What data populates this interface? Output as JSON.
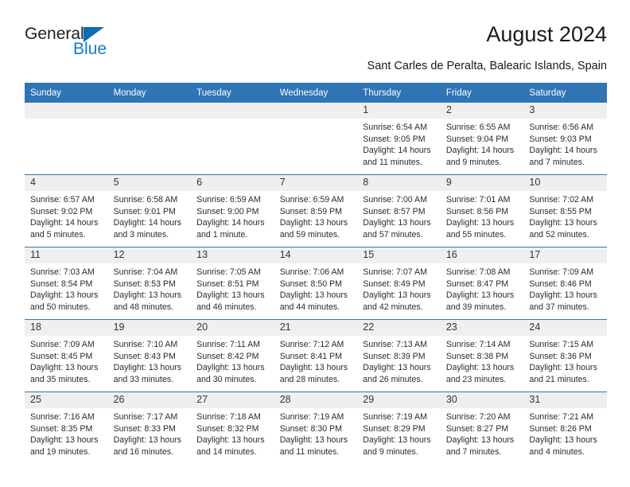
{
  "brand": {
    "name_top": "General",
    "name_bottom": "Blue",
    "triangle_color": "#0b6cb7",
    "text_color": "#231f20",
    "blue_color": "#0f7dc8"
  },
  "header": {
    "title": "August 2024",
    "subtitle": "Sant Carles de Peralta, Balearic Islands, Spain"
  },
  "theme": {
    "header_bg": "#2f74b5",
    "header_text": "#ffffff",
    "daynum_bg": "#efefef",
    "row_divider": "#2f74b5",
    "body_text": "#2b2b2b"
  },
  "calendar": {
    "weekday_headers": [
      "Sunday",
      "Monday",
      "Tuesday",
      "Wednesday",
      "Thursday",
      "Friday",
      "Saturday"
    ],
    "weeks": [
      [
        {
          "day": "",
          "lines": []
        },
        {
          "day": "",
          "lines": []
        },
        {
          "day": "",
          "lines": []
        },
        {
          "day": "",
          "lines": []
        },
        {
          "day": "1",
          "lines": [
            "Sunrise: 6:54 AM",
            "Sunset: 9:05 PM",
            "Daylight: 14 hours",
            "and 11 minutes."
          ]
        },
        {
          "day": "2",
          "lines": [
            "Sunrise: 6:55 AM",
            "Sunset: 9:04 PM",
            "Daylight: 14 hours",
            "and 9 minutes."
          ]
        },
        {
          "day": "3",
          "lines": [
            "Sunrise: 6:56 AM",
            "Sunset: 9:03 PM",
            "Daylight: 14 hours",
            "and 7 minutes."
          ]
        }
      ],
      [
        {
          "day": "4",
          "lines": [
            "Sunrise: 6:57 AM",
            "Sunset: 9:02 PM",
            "Daylight: 14 hours",
            "and 5 minutes."
          ]
        },
        {
          "day": "5",
          "lines": [
            "Sunrise: 6:58 AM",
            "Sunset: 9:01 PM",
            "Daylight: 14 hours",
            "and 3 minutes."
          ]
        },
        {
          "day": "6",
          "lines": [
            "Sunrise: 6:59 AM",
            "Sunset: 9:00 PM",
            "Daylight: 14 hours",
            "and 1 minute."
          ]
        },
        {
          "day": "7",
          "lines": [
            "Sunrise: 6:59 AM",
            "Sunset: 8:59 PM",
            "Daylight: 13 hours",
            "and 59 minutes."
          ]
        },
        {
          "day": "8",
          "lines": [
            "Sunrise: 7:00 AM",
            "Sunset: 8:57 PM",
            "Daylight: 13 hours",
            "and 57 minutes."
          ]
        },
        {
          "day": "9",
          "lines": [
            "Sunrise: 7:01 AM",
            "Sunset: 8:56 PM",
            "Daylight: 13 hours",
            "and 55 minutes."
          ]
        },
        {
          "day": "10",
          "lines": [
            "Sunrise: 7:02 AM",
            "Sunset: 8:55 PM",
            "Daylight: 13 hours",
            "and 52 minutes."
          ]
        }
      ],
      [
        {
          "day": "11",
          "lines": [
            "Sunrise: 7:03 AM",
            "Sunset: 8:54 PM",
            "Daylight: 13 hours",
            "and 50 minutes."
          ]
        },
        {
          "day": "12",
          "lines": [
            "Sunrise: 7:04 AM",
            "Sunset: 8:53 PM",
            "Daylight: 13 hours",
            "and 48 minutes."
          ]
        },
        {
          "day": "13",
          "lines": [
            "Sunrise: 7:05 AM",
            "Sunset: 8:51 PM",
            "Daylight: 13 hours",
            "and 46 minutes."
          ]
        },
        {
          "day": "14",
          "lines": [
            "Sunrise: 7:06 AM",
            "Sunset: 8:50 PM",
            "Daylight: 13 hours",
            "and 44 minutes."
          ]
        },
        {
          "day": "15",
          "lines": [
            "Sunrise: 7:07 AM",
            "Sunset: 8:49 PM",
            "Daylight: 13 hours",
            "and 42 minutes."
          ]
        },
        {
          "day": "16",
          "lines": [
            "Sunrise: 7:08 AM",
            "Sunset: 8:47 PM",
            "Daylight: 13 hours",
            "and 39 minutes."
          ]
        },
        {
          "day": "17",
          "lines": [
            "Sunrise: 7:09 AM",
            "Sunset: 8:46 PM",
            "Daylight: 13 hours",
            "and 37 minutes."
          ]
        }
      ],
      [
        {
          "day": "18",
          "lines": [
            "Sunrise: 7:09 AM",
            "Sunset: 8:45 PM",
            "Daylight: 13 hours",
            "and 35 minutes."
          ]
        },
        {
          "day": "19",
          "lines": [
            "Sunrise: 7:10 AM",
            "Sunset: 8:43 PM",
            "Daylight: 13 hours",
            "and 33 minutes."
          ]
        },
        {
          "day": "20",
          "lines": [
            "Sunrise: 7:11 AM",
            "Sunset: 8:42 PM",
            "Daylight: 13 hours",
            "and 30 minutes."
          ]
        },
        {
          "day": "21",
          "lines": [
            "Sunrise: 7:12 AM",
            "Sunset: 8:41 PM",
            "Daylight: 13 hours",
            "and 28 minutes."
          ]
        },
        {
          "day": "22",
          "lines": [
            "Sunrise: 7:13 AM",
            "Sunset: 8:39 PM",
            "Daylight: 13 hours",
            "and 26 minutes."
          ]
        },
        {
          "day": "23",
          "lines": [
            "Sunrise: 7:14 AM",
            "Sunset: 8:38 PM",
            "Daylight: 13 hours",
            "and 23 minutes."
          ]
        },
        {
          "day": "24",
          "lines": [
            "Sunrise: 7:15 AM",
            "Sunset: 8:36 PM",
            "Daylight: 13 hours",
            "and 21 minutes."
          ]
        }
      ],
      [
        {
          "day": "25",
          "lines": [
            "Sunrise: 7:16 AM",
            "Sunset: 8:35 PM",
            "Daylight: 13 hours",
            "and 19 minutes."
          ]
        },
        {
          "day": "26",
          "lines": [
            "Sunrise: 7:17 AM",
            "Sunset: 8:33 PM",
            "Daylight: 13 hours",
            "and 16 minutes."
          ]
        },
        {
          "day": "27",
          "lines": [
            "Sunrise: 7:18 AM",
            "Sunset: 8:32 PM",
            "Daylight: 13 hours",
            "and 14 minutes."
          ]
        },
        {
          "day": "28",
          "lines": [
            "Sunrise: 7:19 AM",
            "Sunset: 8:30 PM",
            "Daylight: 13 hours",
            "and 11 minutes."
          ]
        },
        {
          "day": "29",
          "lines": [
            "Sunrise: 7:19 AM",
            "Sunset: 8:29 PM",
            "Daylight: 13 hours",
            "and 9 minutes."
          ]
        },
        {
          "day": "30",
          "lines": [
            "Sunrise: 7:20 AM",
            "Sunset: 8:27 PM",
            "Daylight: 13 hours",
            "and 7 minutes."
          ]
        },
        {
          "day": "31",
          "lines": [
            "Sunrise: 7:21 AM",
            "Sunset: 8:26 PM",
            "Daylight: 13 hours",
            "and 4 minutes."
          ]
        }
      ]
    ]
  }
}
